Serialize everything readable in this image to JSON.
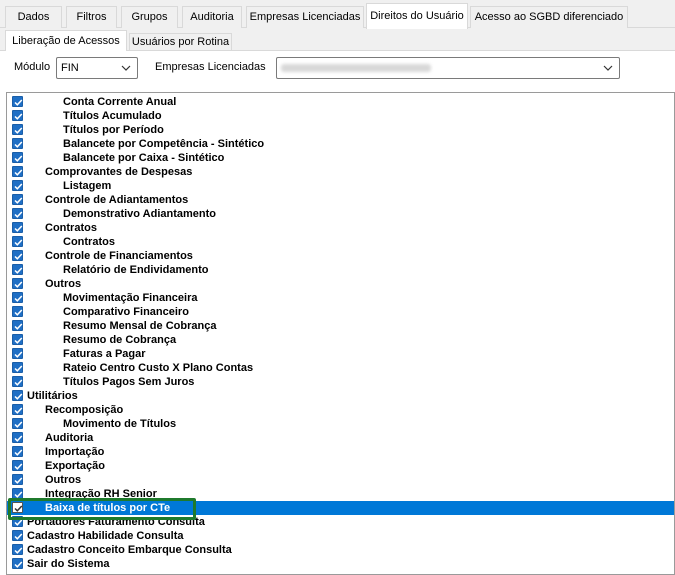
{
  "tabs": [
    {
      "label": "Dados"
    },
    {
      "label": "Filtros"
    },
    {
      "label": "Grupos"
    },
    {
      "label": "Auditoria"
    },
    {
      "label": "Empresas Licenciadas"
    },
    {
      "label": "Direitos do Usuário"
    },
    {
      "label": "Acesso ao SGBD diferenciado"
    }
  ],
  "active_tab": "Direitos do Usuário",
  "subtabs": [
    {
      "label": "Liberação de Acessos"
    },
    {
      "label": "Usuários por Rotina"
    }
  ],
  "filters": {
    "modulo_label": "Módulo",
    "modulo_value": "FIN",
    "empresas_label": "Empresas Licenciadas",
    "empresas_value": ""
  },
  "tree": [
    {
      "label": "Conta Corrente Anual",
      "level": 2,
      "checked": true
    },
    {
      "label": "Títulos Acumulado",
      "level": 2,
      "checked": true
    },
    {
      "label": "Títulos por Período",
      "level": 2,
      "checked": true
    },
    {
      "label": "Balancete por Competência - Sintético",
      "level": 2,
      "checked": true
    },
    {
      "label": "Balancete por Caixa - Sintético",
      "level": 2,
      "checked": true
    },
    {
      "label": "Comprovantes de Despesas",
      "level": 1,
      "checked": true
    },
    {
      "label": "Listagem",
      "level": 2,
      "checked": true
    },
    {
      "label": "Controle de Adiantamentos",
      "level": 1,
      "checked": true
    },
    {
      "label": "Demonstrativo Adiantamento",
      "level": 2,
      "checked": true
    },
    {
      "label": "Contratos",
      "level": 1,
      "checked": true
    },
    {
      "label": "Contratos",
      "level": 2,
      "checked": true
    },
    {
      "label": "Controle de Financiamentos",
      "level": 1,
      "checked": true
    },
    {
      "label": "Relatório de Endividamento",
      "level": 2,
      "checked": true
    },
    {
      "label": "Outros",
      "level": 1,
      "checked": true
    },
    {
      "label": "Movimentação Financeira",
      "level": 2,
      "checked": true
    },
    {
      "label": "Comparativo Financeiro",
      "level": 2,
      "checked": true
    },
    {
      "label": "Resumo Mensal de Cobrança",
      "level": 2,
      "checked": true
    },
    {
      "label": "Resumo de Cobrança",
      "level": 2,
      "checked": true
    },
    {
      "label": "Faturas a Pagar",
      "level": 2,
      "checked": true
    },
    {
      "label": "Rateio Centro Custo X Plano Contas",
      "level": 2,
      "checked": true
    },
    {
      "label": "Títulos Pagos Sem Juros",
      "level": 2,
      "checked": true
    },
    {
      "label": "Utilitários",
      "level": 0,
      "checked": true
    },
    {
      "label": "Recomposição",
      "level": 1,
      "checked": true
    },
    {
      "label": "Movimento de Títulos",
      "level": 2,
      "checked": true
    },
    {
      "label": "Auditoria",
      "level": 1,
      "checked": true
    },
    {
      "label": "Importação",
      "level": 1,
      "checked": true
    },
    {
      "label": "Exportação",
      "level": 1,
      "checked": true
    },
    {
      "label": "Outros",
      "level": 1,
      "checked": true
    },
    {
      "label": "Integração RH Senior",
      "level": 1,
      "checked": true
    },
    {
      "label": "Baixa de títulos por CTe",
      "level": 1,
      "checked": true,
      "selected": true
    },
    {
      "label": "Portadores Faturamento Consulta",
      "level": 0,
      "checked": true
    },
    {
      "label": "Cadastro Habilidade Consulta",
      "level": 0,
      "checked": true
    },
    {
      "label": "Cadastro Conceito Embarque Consulta",
      "level": 0,
      "checked": true
    },
    {
      "label": "Sair do Sistema",
      "level": 0,
      "checked": true
    }
  ],
  "colors": {
    "selection": "#0078d7",
    "checkbox": "#1f6fc5",
    "highlight_box": "#1f7a2c"
  },
  "icons": {
    "checkbox": "checkmark-icon",
    "dropdown": "chevron-down-icon"
  }
}
